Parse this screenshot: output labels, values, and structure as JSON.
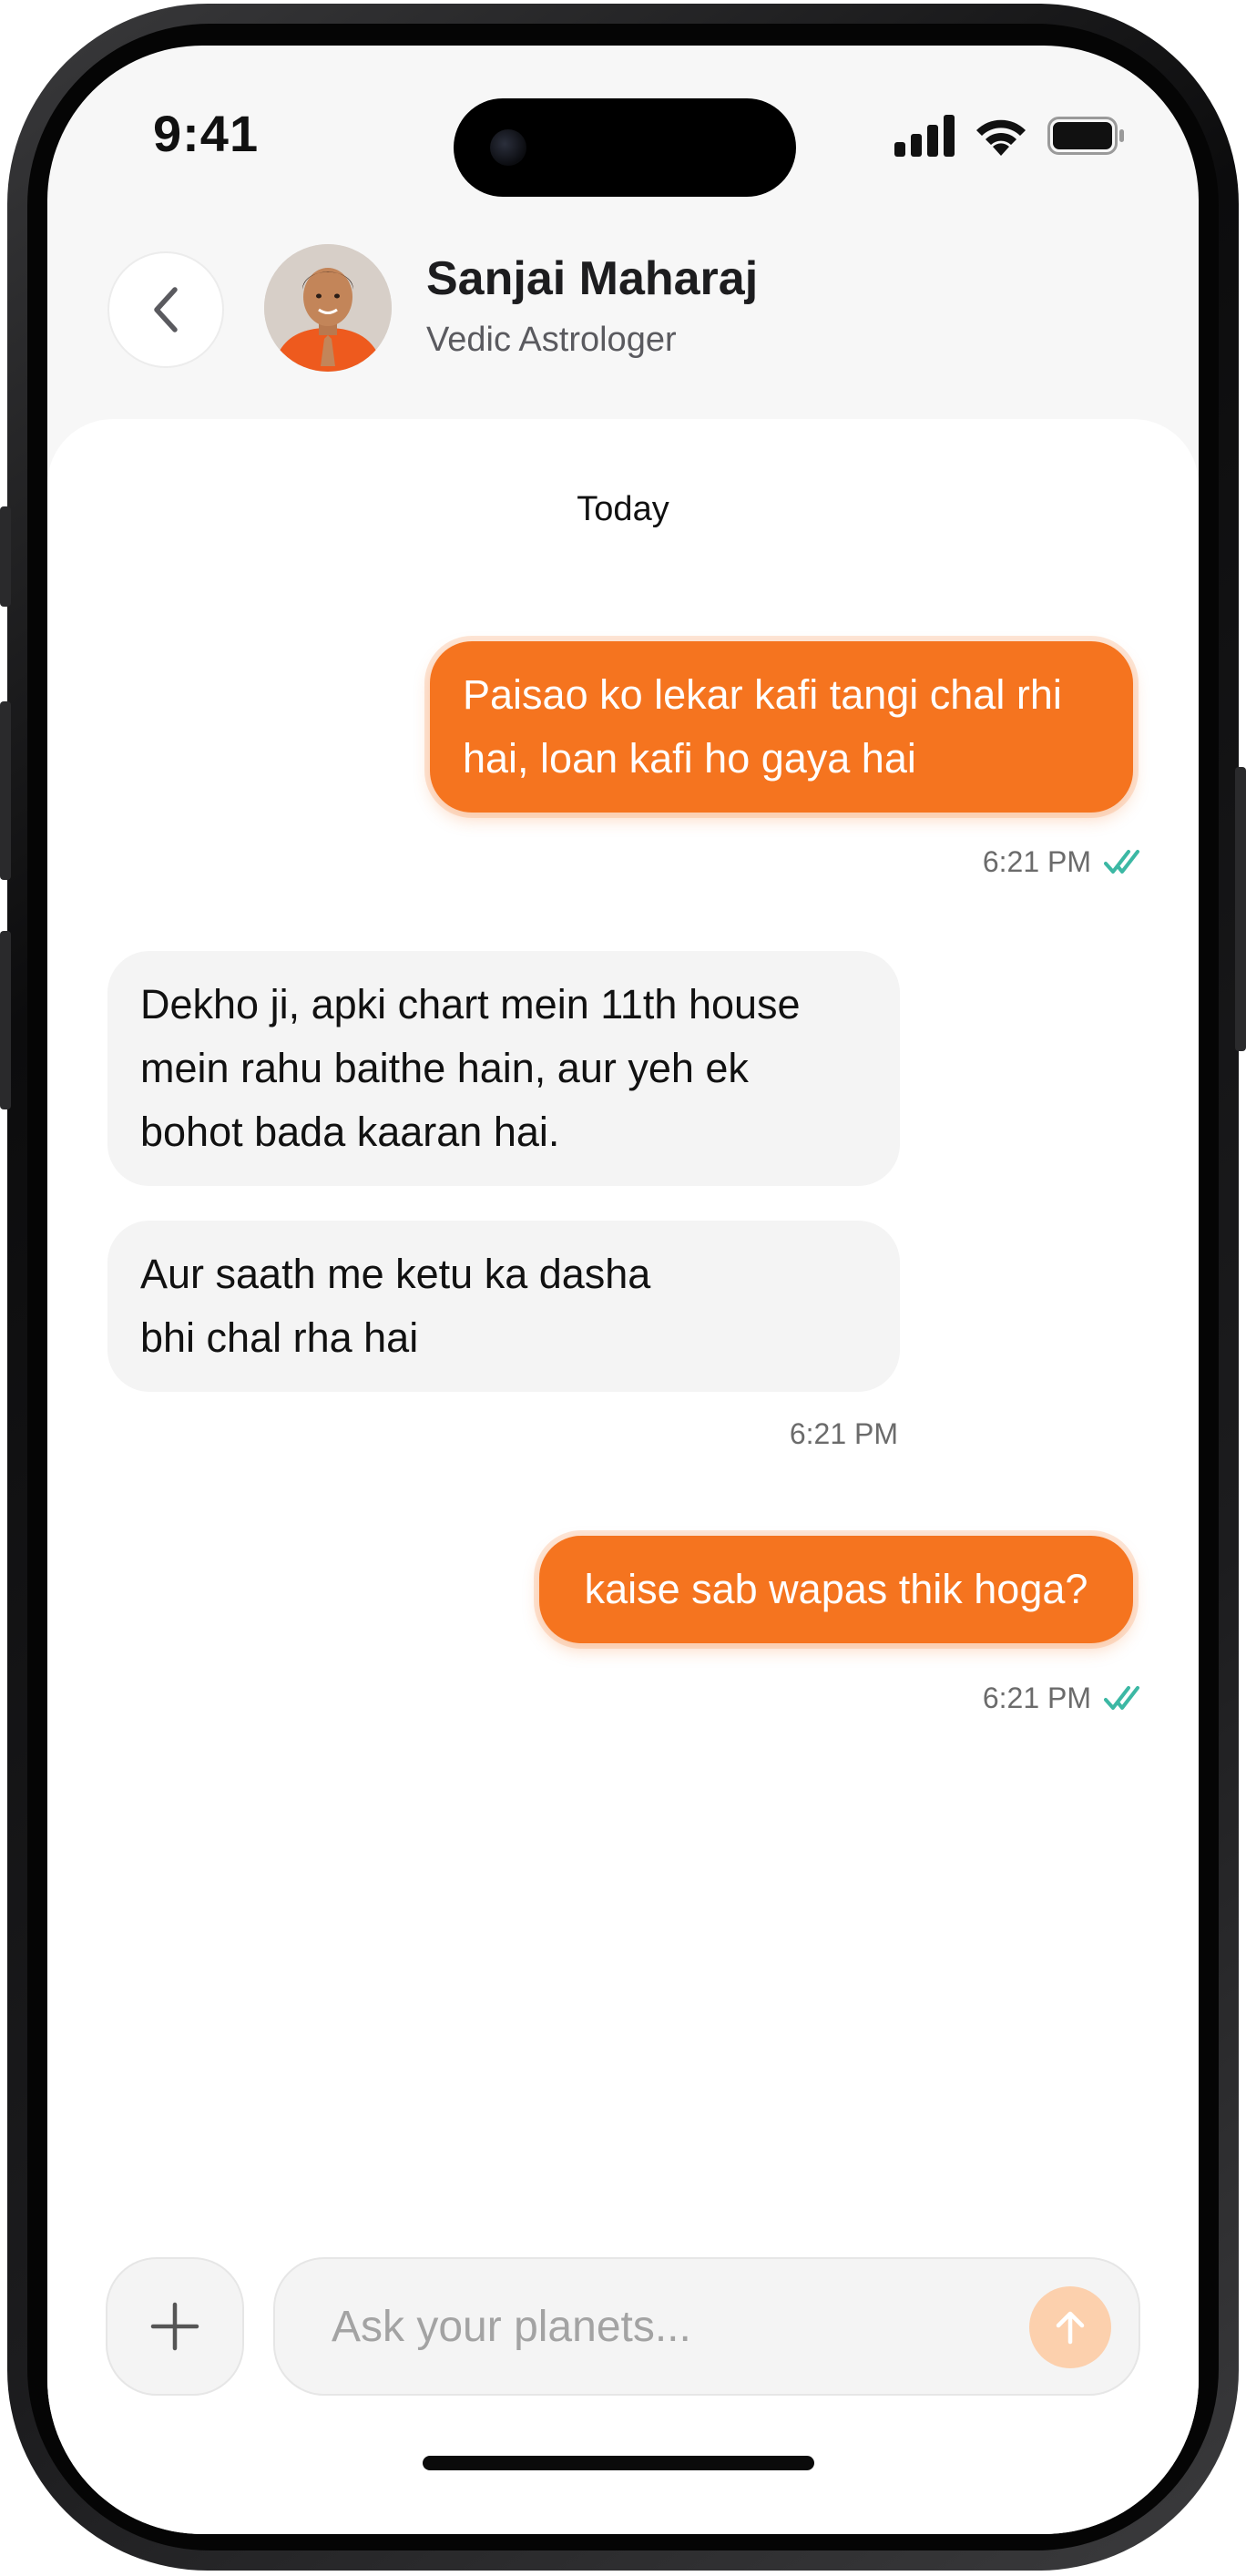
{
  "status_bar": {
    "time": "9:41",
    "icons": [
      "cellular-signal-icon",
      "wifi-icon",
      "battery-icon"
    ]
  },
  "header": {
    "back_icon": "chevron-left-icon",
    "contact_name": "Sanjai Maharaj",
    "contact_role": "Vedic Astrologer"
  },
  "chat": {
    "date_divider": "Today",
    "messages": [
      {
        "direction": "outgoing",
        "lines": [
          "Paisao ko lekar kafi tangi chal rhi",
          "hai, loan kafi ho gaya hai"
        ],
        "time": "6:21 PM",
        "status": "read"
      },
      {
        "direction": "incoming",
        "lines": [
          "Dekho ji, apki chart mein 11th house",
          "mein rahu baithe hain, aur yeh ek",
          "bohot bada kaaran hai."
        ]
      },
      {
        "direction": "incoming",
        "lines": [
          "Aur saath me ketu ka dasha",
          "bhi chal rha hai"
        ],
        "time": "6:21 PM"
      },
      {
        "direction": "outgoing",
        "lines": [
          "kaise sab wapas thik hoga?"
        ],
        "time": "6:21 PM",
        "status": "read"
      }
    ]
  },
  "composer": {
    "add_icon": "plus-icon",
    "placeholder": "Ask your planets...",
    "value": "",
    "send_icon": "arrow-up-icon"
  },
  "colors": {
    "accent": "#f5741f",
    "accent_soft": "#fcd0ad",
    "read_receipt": "#3cb8a4",
    "incoming_bubble": "#f4f4f4",
    "panel_background": "#f7f7f7"
  }
}
